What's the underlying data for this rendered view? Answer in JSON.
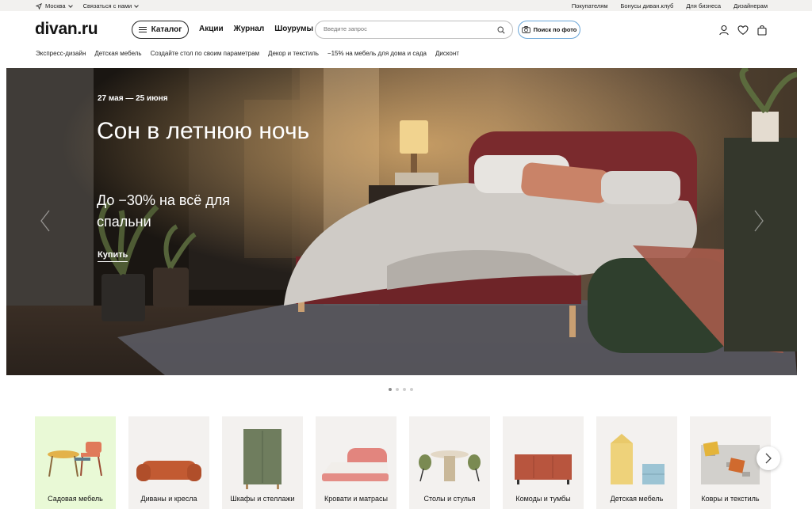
{
  "topbar": {
    "city": "Москва",
    "contact": "Связаться с нами",
    "links": [
      "Покупателям",
      "Бонусы диван.клуб",
      "Для бизнеса",
      "Дизайнерам"
    ]
  },
  "header": {
    "logo": "divan.ru",
    "catalog_label": "Каталог",
    "nav": [
      "Акции",
      "Журнал",
      "Шоурумы"
    ],
    "search_placeholder": "Введите запрос",
    "photo_search_label": "Поиск по фото"
  },
  "subnav": [
    "Экспресс-дизайн",
    "Детская мебель",
    "Создайте стол по своим параметрам",
    "Декор и текстиль",
    "−15% на мебель для дома и сада",
    "Дисконт"
  ],
  "hero": {
    "date": "27 мая — 25 июня",
    "title": "Сон в летнюю ночь",
    "subtitle": "До −30% на всё для спальни",
    "cta": "Купить"
  },
  "carousel": {
    "total": 4,
    "active": 0
  },
  "categories": [
    {
      "label": "Садовая мебель"
    },
    {
      "label": "Диваны и кресла"
    },
    {
      "label": "Шкафы и стеллажи"
    },
    {
      "label": "Кровати и матрасы"
    },
    {
      "label": "Столы и стулья"
    },
    {
      "label": "Комоды и тумбы"
    },
    {
      "label": "Детская мебель"
    },
    {
      "label": "Ковры и текстиль"
    }
  ],
  "colors": {
    "accent_photo_border": "#6aa6d8",
    "topbar_bg": "#f2f1ef",
    "garden_tile_bg": "#e9f9d6",
    "tile_bg": "#f3f1ef"
  }
}
